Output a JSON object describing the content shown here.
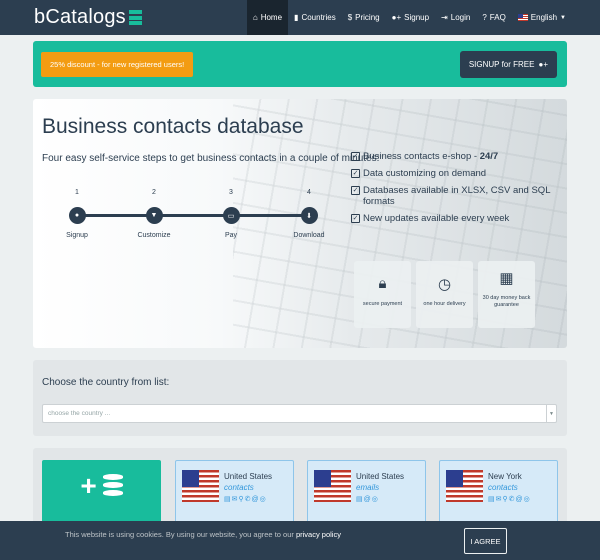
{
  "brand": {
    "name": "bCatalogs"
  },
  "nav": {
    "items": [
      {
        "label": "Home",
        "icon": "home-icon"
      },
      {
        "label": "Countries",
        "icon": "map-icon"
      },
      {
        "label": "Pricing",
        "icon": "dollar-icon"
      },
      {
        "label": "Signup",
        "icon": "user-plus-icon"
      },
      {
        "label": "Login",
        "icon": "login-icon"
      },
      {
        "label": "FAQ",
        "icon": "question-icon"
      },
      {
        "label": "English",
        "icon": "flag-icon"
      }
    ],
    "active": "Home"
  },
  "promo": {
    "badge": "25% discount - for new registered users!",
    "button": "SIGNUP for FREE"
  },
  "hero": {
    "title": "Business contacts database",
    "subtitle": "Four easy self-service steps to get business contacts in a couple of minutes:",
    "steps": [
      {
        "num": "1",
        "label": "Signup",
        "icon": "user-plus-icon"
      },
      {
        "num": "2",
        "label": "Customize",
        "icon": "filter-icon"
      },
      {
        "num": "3",
        "label": "Pay",
        "icon": "credit-card-icon"
      },
      {
        "num": "4",
        "label": "Download",
        "icon": "download-icon"
      }
    ],
    "features": [
      {
        "text": "Business contacts e-shop - ",
        "strong": "24/7"
      },
      {
        "text": "Data customizing on demand",
        "strong": ""
      },
      {
        "text": "Databases available in XLSX, CSV and SQL formats",
        "strong": ""
      },
      {
        "text": "New updates available every week",
        "strong": ""
      }
    ],
    "badges": [
      {
        "label": "secure payment",
        "icon": "lock-icon"
      },
      {
        "label": "one hour delivery",
        "icon": "clock-icon"
      },
      {
        "label": "30 day money back guarantee",
        "icon": "calendar-icon"
      }
    ]
  },
  "country": {
    "title": "Choose the country from list:",
    "placeholder": "choose the country ..."
  },
  "products": [
    {
      "country": "United States",
      "kind": "contacts"
    },
    {
      "country": "United States",
      "kind": "emails"
    },
    {
      "country": "New York",
      "kind": "contacts"
    }
  ],
  "cookie": {
    "text": "This website is using cookies. By using our website, you agree to our ",
    "link": "privacy policy",
    "button": "I AGREE"
  },
  "colors": {
    "navy": "#2c3e50",
    "teal": "#18bc9c",
    "orange": "#f39c12",
    "blue": "#3498db"
  }
}
